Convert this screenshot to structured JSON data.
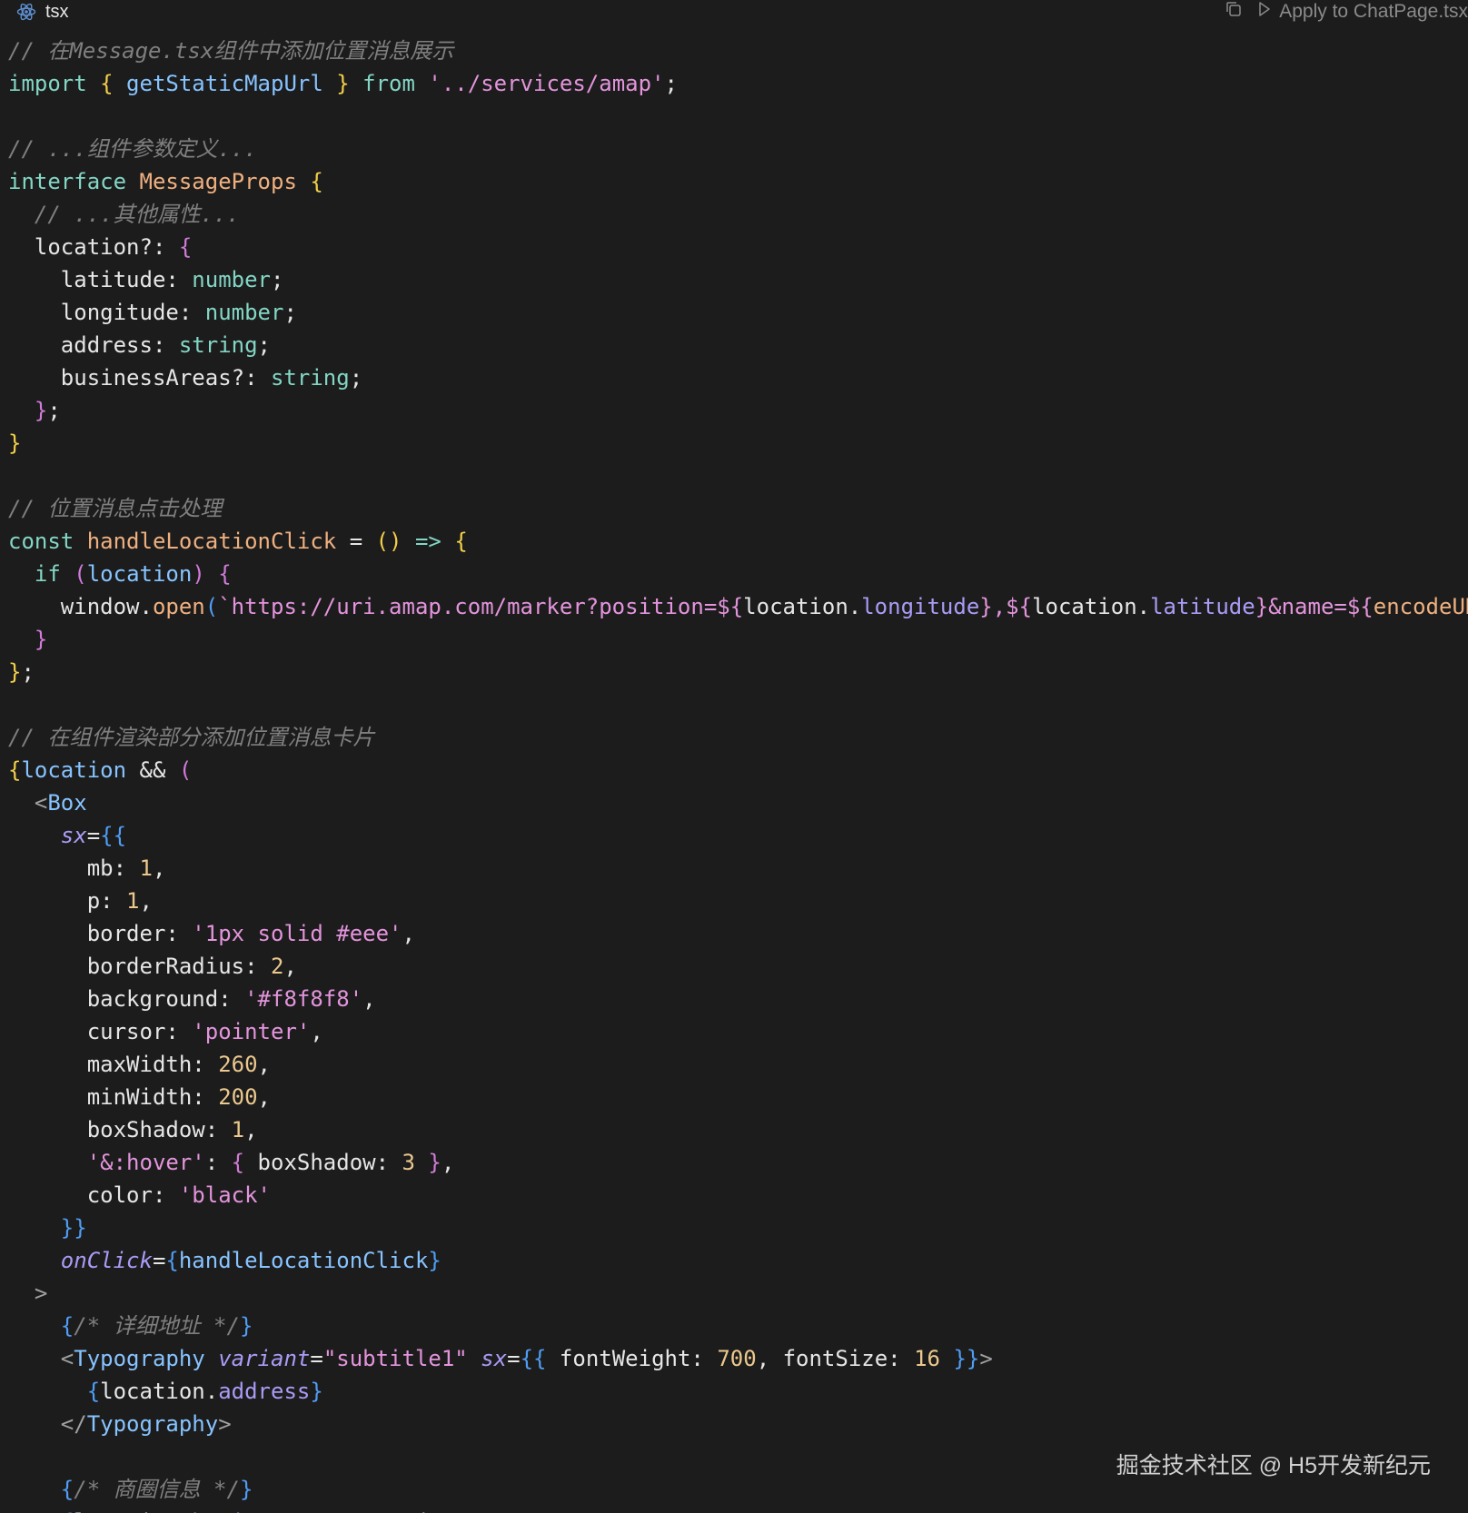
{
  "header": {
    "language": "tsx",
    "language_icon": "react-icon",
    "copy_icon": "copy-icon",
    "apply_icon": "play-icon",
    "apply_label": "Apply to ChatPage.tsx"
  },
  "colors": {
    "background": "#1c1c1c",
    "comment": "#7f7f7f",
    "keyword": "#83d6c5",
    "plain": "#e6e6e6",
    "func": "#efb080",
    "type": "#efb080",
    "string": "#e394dc",
    "number": "#ebc88d",
    "brace1": "#f2cf4a",
    "brace2": "#d07bd8",
    "brace3": "#4f9df4",
    "prop": "#aa9bf5",
    "tag": "#87c3ff",
    "attr": "#aa9bf5",
    "punct": "#a0a0a0"
  },
  "code_lines": [
    [
      [
        "// 在Message.tsx组件中添加位置消息展示",
        "comment"
      ]
    ],
    [
      [
        "import",
        "keyword"
      ],
      [
        " ",
        "plain"
      ],
      [
        "{",
        "brace1"
      ],
      [
        " getStaticMapUrl ",
        "tag"
      ],
      [
        "}",
        "brace1"
      ],
      [
        " ",
        "plain"
      ],
      [
        "from",
        "keyword"
      ],
      [
        " ",
        "plain"
      ],
      [
        "'../services/amap'",
        "string"
      ],
      [
        ";",
        "plain"
      ]
    ],
    [],
    [
      [
        "// ...组件参数定义...",
        "comment"
      ]
    ],
    [
      [
        "interface",
        "keyword"
      ],
      [
        " ",
        "plain"
      ],
      [
        "MessageProps",
        "type"
      ],
      [
        " ",
        "plain"
      ],
      [
        "{",
        "brace1"
      ]
    ],
    [
      [
        "  ",
        "plain"
      ],
      [
        "// ...其他属性...",
        "comment"
      ]
    ],
    [
      [
        "  location?: ",
        "plain"
      ],
      [
        "{",
        "brace2"
      ]
    ],
    [
      [
        "    latitude: ",
        "plain"
      ],
      [
        "number",
        "keyword"
      ],
      [
        ";",
        "plain"
      ]
    ],
    [
      [
        "    longitude: ",
        "plain"
      ],
      [
        "number",
        "keyword"
      ],
      [
        ";",
        "plain"
      ]
    ],
    [
      [
        "    address: ",
        "plain"
      ],
      [
        "string",
        "keyword"
      ],
      [
        ";",
        "plain"
      ]
    ],
    [
      [
        "    businessAreas?: ",
        "plain"
      ],
      [
        "string",
        "keyword"
      ],
      [
        ";",
        "plain"
      ]
    ],
    [
      [
        "  ",
        "plain"
      ],
      [
        "}",
        "brace2"
      ],
      [
        ";",
        "plain"
      ]
    ],
    [
      [
        "}",
        "brace1"
      ]
    ],
    [],
    [
      [
        "// 位置消息点击处理",
        "comment"
      ]
    ],
    [
      [
        "const",
        "keyword"
      ],
      [
        " ",
        "plain"
      ],
      [
        "handleLocationClick",
        "func"
      ],
      [
        " = ",
        "plain"
      ],
      [
        "()",
        "brace1"
      ],
      [
        " ",
        "plain"
      ],
      [
        "=>",
        "keyword"
      ],
      [
        " ",
        "plain"
      ],
      [
        "{",
        "brace1"
      ]
    ],
    [
      [
        "  ",
        "plain"
      ],
      [
        "if",
        "keyword"
      ],
      [
        " ",
        "plain"
      ],
      [
        "(",
        "brace2"
      ],
      [
        "location",
        "tag"
      ],
      [
        ")",
        "brace2"
      ],
      [
        " ",
        "plain"
      ],
      [
        "{",
        "brace2"
      ]
    ],
    [
      [
        "    window.",
        "plain"
      ],
      [
        "open",
        "func"
      ],
      [
        "(",
        "brace3"
      ],
      [
        "`https://uri.amap.com/marker?position=${",
        "string"
      ],
      [
        "location.",
        "plain"
      ],
      [
        "longitude",
        "prop"
      ],
      [
        "},${",
        "string"
      ],
      [
        "location.",
        "plain"
      ],
      [
        "latitude",
        "prop"
      ],
      [
        "}&name=${",
        "string"
      ],
      [
        "encodeURIComponent",
        "func"
      ]
    ],
    [
      [
        "  ",
        "plain"
      ],
      [
        "}",
        "brace2"
      ]
    ],
    [
      [
        "}",
        "brace1"
      ],
      [
        ";",
        "plain"
      ]
    ],
    [],
    [
      [
        "// 在组件渲染部分添加位置消息卡片",
        "comment"
      ]
    ],
    [
      [
        "{",
        "brace1"
      ],
      [
        "location",
        "tag"
      ],
      [
        " && ",
        "plain"
      ],
      [
        "(",
        "brace2"
      ]
    ],
    [
      [
        "  ",
        "plain"
      ],
      [
        "<",
        "punct"
      ],
      [
        "Box",
        "tag"
      ]
    ],
    [
      [
        "    ",
        "plain"
      ],
      [
        "sx",
        "attr"
      ],
      [
        "=",
        "plain"
      ],
      [
        "{{",
        "brace3"
      ]
    ],
    [
      [
        "      mb: ",
        "plain"
      ],
      [
        "1",
        "number"
      ],
      [
        ",",
        "plain"
      ]
    ],
    [
      [
        "      p: ",
        "plain"
      ],
      [
        "1",
        "number"
      ],
      [
        ",",
        "plain"
      ]
    ],
    [
      [
        "      border: ",
        "plain"
      ],
      [
        "'1px solid #eee'",
        "string"
      ],
      [
        ",",
        "plain"
      ]
    ],
    [
      [
        "      borderRadius: ",
        "plain"
      ],
      [
        "2",
        "number"
      ],
      [
        ",",
        "plain"
      ]
    ],
    [
      [
        "      background: ",
        "plain"
      ],
      [
        "'#f8f8f8'",
        "string"
      ],
      [
        ",",
        "plain"
      ]
    ],
    [
      [
        "      cursor: ",
        "plain"
      ],
      [
        "'pointer'",
        "string"
      ],
      [
        ",",
        "plain"
      ]
    ],
    [
      [
        "      maxWidth: ",
        "plain"
      ],
      [
        "260",
        "number"
      ],
      [
        ",",
        "plain"
      ]
    ],
    [
      [
        "      minWidth: ",
        "plain"
      ],
      [
        "200",
        "number"
      ],
      [
        ",",
        "plain"
      ]
    ],
    [
      [
        "      boxShadow: ",
        "plain"
      ],
      [
        "1",
        "number"
      ],
      [
        ",",
        "plain"
      ]
    ],
    [
      [
        "      ",
        "plain"
      ],
      [
        "'&:hover'",
        "string"
      ],
      [
        ": ",
        "plain"
      ],
      [
        "{",
        "brace2"
      ],
      [
        " boxShadow: ",
        "plain"
      ],
      [
        "3",
        "number"
      ],
      [
        " ",
        "plain"
      ],
      [
        "}",
        "brace2"
      ],
      [
        ",",
        "plain"
      ]
    ],
    [
      [
        "      color: ",
        "plain"
      ],
      [
        "'black'",
        "string"
      ]
    ],
    [
      [
        "    ",
        "plain"
      ],
      [
        "}}",
        "brace3"
      ]
    ],
    [
      [
        "    ",
        "plain"
      ],
      [
        "onClick",
        "attr"
      ],
      [
        "=",
        "plain"
      ],
      [
        "{",
        "brace3"
      ],
      [
        "handleLocationClick",
        "tag"
      ],
      [
        "}",
        "brace3"
      ]
    ],
    [
      [
        "  ",
        "plain"
      ],
      [
        ">",
        "punct"
      ]
    ],
    [
      [
        "    ",
        "plain"
      ],
      [
        "{",
        "brace3"
      ],
      [
        "/* 详细地址 */",
        "comment"
      ],
      [
        "}",
        "brace3"
      ]
    ],
    [
      [
        "    ",
        "plain"
      ],
      [
        "<",
        "punct"
      ],
      [
        "Typography",
        "tag"
      ],
      [
        " ",
        "plain"
      ],
      [
        "variant",
        "attr"
      ],
      [
        "=",
        "plain"
      ],
      [
        "\"subtitle1\"",
        "string"
      ],
      [
        " ",
        "plain"
      ],
      [
        "sx",
        "attr"
      ],
      [
        "=",
        "plain"
      ],
      [
        "{{",
        "brace3"
      ],
      [
        " fontWeight: ",
        "plain"
      ],
      [
        "700",
        "number"
      ],
      [
        ", fontSize: ",
        "plain"
      ],
      [
        "16",
        "number"
      ],
      [
        " ",
        "plain"
      ],
      [
        "}}",
        "brace3"
      ],
      [
        ">",
        "punct"
      ]
    ],
    [
      [
        "      ",
        "plain"
      ],
      [
        "{",
        "brace3"
      ],
      [
        "location.",
        "plain"
      ],
      [
        "address",
        "prop"
      ],
      [
        "}",
        "brace3"
      ]
    ],
    [
      [
        "    ",
        "plain"
      ],
      [
        "</",
        "punct"
      ],
      [
        "Typography",
        "tag"
      ],
      [
        ">",
        "punct"
      ]
    ],
    [],
    [
      [
        "    ",
        "plain"
      ],
      [
        "{",
        "brace3"
      ],
      [
        "/* 商圈信息 */",
        "comment"
      ],
      [
        "}",
        "brace3"
      ]
    ],
    [
      [
        "    ",
        "plain"
      ],
      [
        "{",
        "brace3"
      ],
      [
        "location.",
        "plain"
      ],
      [
        "businessAreas",
        "prop"
      ],
      [
        " && (",
        "plain"
      ]
    ]
  ],
  "watermark": "掘金技术社区 @ H5开发新纪元"
}
